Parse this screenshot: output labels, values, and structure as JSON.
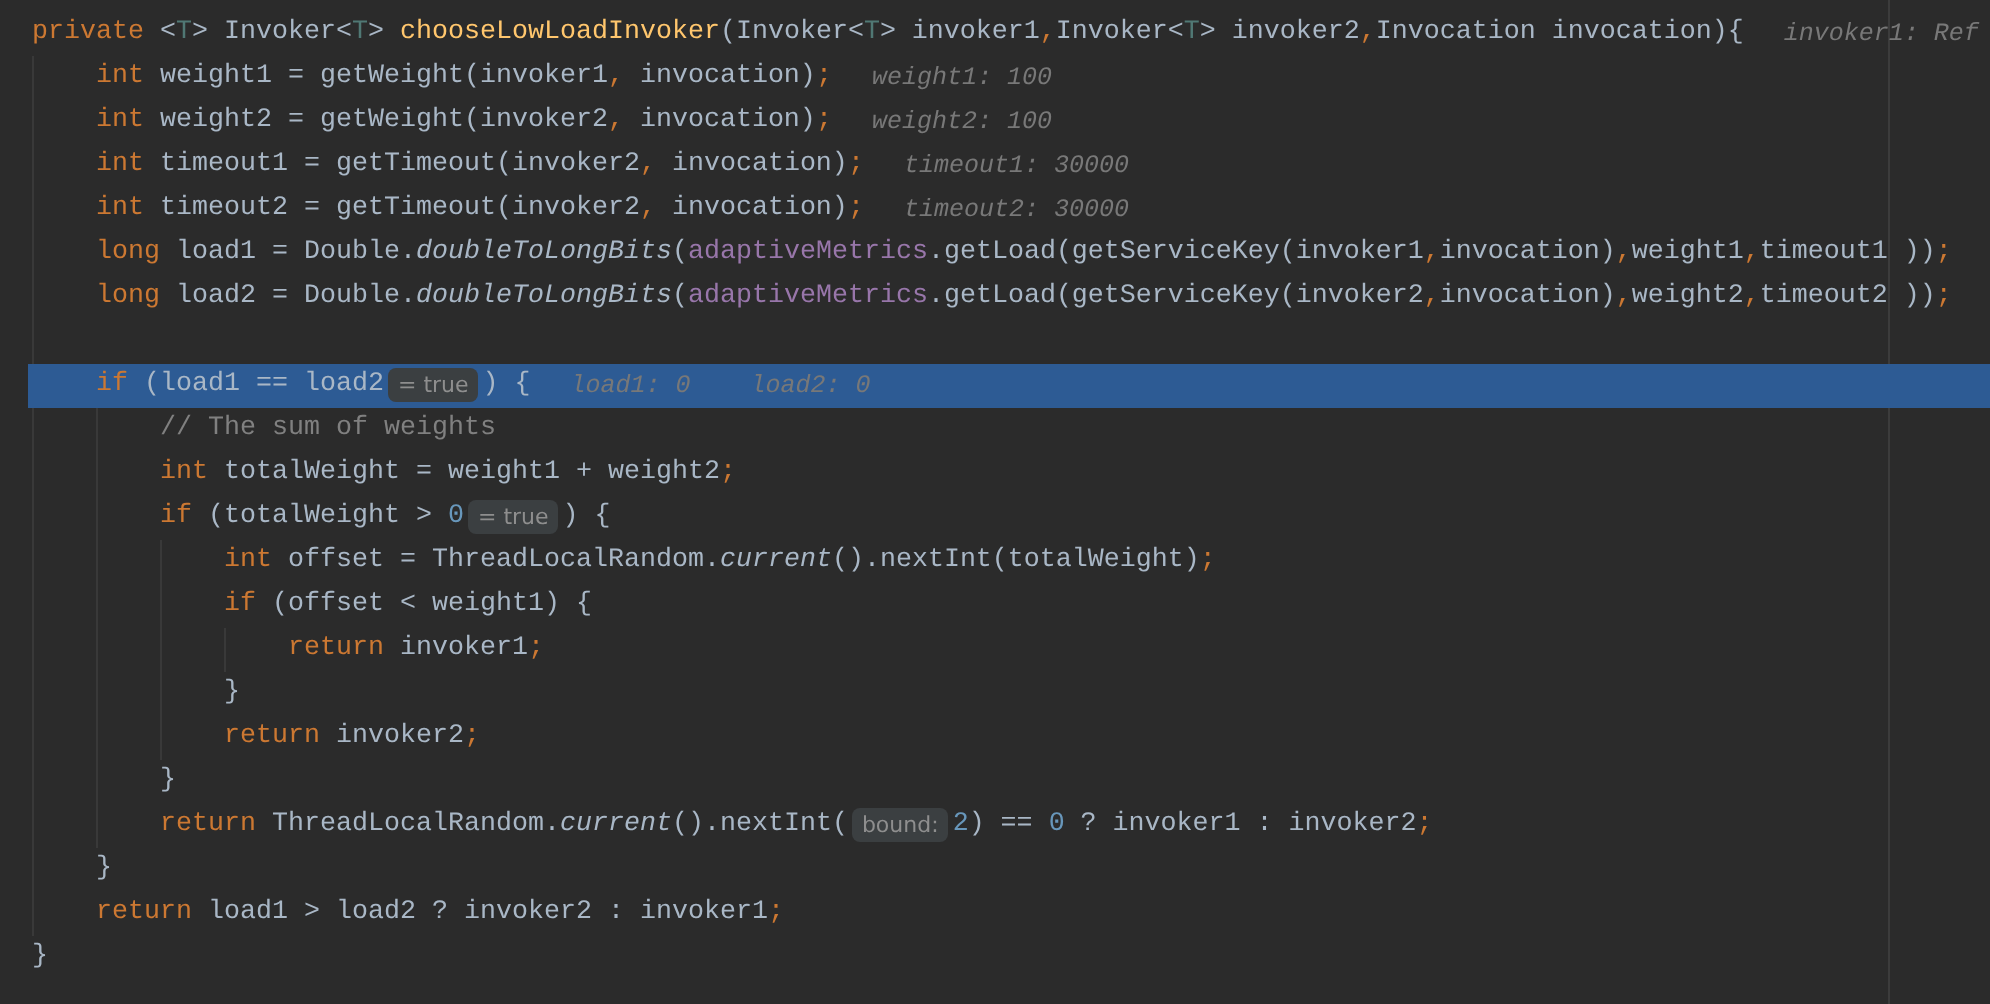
{
  "editor": {
    "lines": [
      {
        "current": false,
        "segments": [
          {
            "kind": "code",
            "tokens": [
              {
                "text": "private ",
                "kind": "kw"
              },
              {
                "text": "<",
                "kind": "plain"
              },
              {
                "text": "T",
                "kind": "tparam"
              },
              {
                "text": "> Invoker<",
                "kind": "plain"
              },
              {
                "text": "T",
                "kind": "tparam"
              },
              {
                "text": "> ",
                "kind": "plain"
              },
              {
                "text": "chooseLowLoadInvoker",
                "kind": "decl"
              },
              {
                "text": "(Invoker<",
                "kind": "plain"
              },
              {
                "text": "T",
                "kind": "tparam"
              },
              {
                "text": "> invoker1",
                "kind": "plain"
              },
              {
                "text": ",",
                "kind": "punct"
              },
              {
                "text": "Invoker<",
                "kind": "plain"
              },
              {
                "text": "T",
                "kind": "tparam"
              },
              {
                "text": "> invoker2",
                "kind": "plain"
              },
              {
                "text": ",",
                "kind": "punct"
              },
              {
                "text": "Invocation invocation){",
                "kind": "plain"
              }
            ]
          },
          {
            "kind": "value",
            "text": "invoker1: Ref"
          }
        ],
        "children": [
          {
            "current": false,
            "segments": [
              {
                "kind": "code",
                "tokens": [
                  {
                    "text": "int ",
                    "kind": "kw"
                  },
                  {
                    "text": "weight1 = getWeight(invoker1",
                    "kind": "plain"
                  },
                  {
                    "text": ", ",
                    "kind": "punct"
                  },
                  {
                    "text": "invocation)",
                    "kind": "plain"
                  },
                  {
                    "text": ";",
                    "kind": "punct"
                  }
                ]
              },
              {
                "kind": "value",
                "text": "weight1: 100"
              }
            ]
          },
          {
            "current": false,
            "segments": [
              {
                "kind": "code",
                "tokens": [
                  {
                    "text": "int ",
                    "kind": "kw"
                  },
                  {
                    "text": "weight2 = getWeight(invoker2",
                    "kind": "plain"
                  },
                  {
                    "text": ", ",
                    "kind": "punct"
                  },
                  {
                    "text": "invocation)",
                    "kind": "plain"
                  },
                  {
                    "text": ";",
                    "kind": "punct"
                  }
                ]
              },
              {
                "kind": "value",
                "text": "weight2: 100"
              }
            ]
          },
          {
            "current": false,
            "segments": [
              {
                "kind": "code",
                "tokens": [
                  {
                    "text": "int ",
                    "kind": "kw"
                  },
                  {
                    "text": "timeout1 = getTimeout(invoker2",
                    "kind": "plain"
                  },
                  {
                    "text": ", ",
                    "kind": "punct"
                  },
                  {
                    "text": "invocation)",
                    "kind": "plain"
                  },
                  {
                    "text": ";",
                    "kind": "punct"
                  }
                ]
              },
              {
                "kind": "value",
                "text": "timeout1: 30000"
              }
            ]
          },
          {
            "current": false,
            "segments": [
              {
                "kind": "code",
                "tokens": [
                  {
                    "text": "int ",
                    "kind": "kw"
                  },
                  {
                    "text": "timeout2 = getTimeout(invoker2",
                    "kind": "plain"
                  },
                  {
                    "text": ", ",
                    "kind": "punct"
                  },
                  {
                    "text": "invocation)",
                    "kind": "plain"
                  },
                  {
                    "text": ";",
                    "kind": "punct"
                  }
                ]
              },
              {
                "kind": "value",
                "text": "timeout2: 30000"
              }
            ]
          },
          {
            "current": false,
            "segments": [
              {
                "kind": "code",
                "tokens": [
                  {
                    "text": "long ",
                    "kind": "kw"
                  },
                  {
                    "text": "load1 = Double.",
                    "kind": "plain"
                  },
                  {
                    "text": "doubleToLongBits",
                    "kind": "static"
                  },
                  {
                    "text": "(",
                    "kind": "plain"
                  },
                  {
                    "text": "adaptiveMetrics",
                    "kind": "field"
                  },
                  {
                    "text": ".getLoad(getServiceKey(invoker1",
                    "kind": "plain"
                  },
                  {
                    "text": ",",
                    "kind": "punct"
                  },
                  {
                    "text": "invocation)",
                    "kind": "plain"
                  },
                  {
                    "text": ",",
                    "kind": "punct"
                  },
                  {
                    "text": "weight1",
                    "kind": "plain"
                  },
                  {
                    "text": ",",
                    "kind": "punct"
                  },
                  {
                    "text": "timeout1 ))",
                    "kind": "plain"
                  },
                  {
                    "text": ";",
                    "kind": "punct"
                  }
                ]
              }
            ]
          },
          {
            "current": false,
            "segments": [
              {
                "kind": "code",
                "tokens": [
                  {
                    "text": "long ",
                    "kind": "kw"
                  },
                  {
                    "text": "load2 = Double.",
                    "kind": "plain"
                  },
                  {
                    "text": "doubleToLongBits",
                    "kind": "static"
                  },
                  {
                    "text": "(",
                    "kind": "plain"
                  },
                  {
                    "text": "adaptiveMetrics",
                    "kind": "field"
                  },
                  {
                    "text": ".getLoad(getServiceKey(invoker2",
                    "kind": "plain"
                  },
                  {
                    "text": ",",
                    "kind": "punct"
                  },
                  {
                    "text": "invocation)",
                    "kind": "plain"
                  },
                  {
                    "text": ",",
                    "kind": "punct"
                  },
                  {
                    "text": "weight2",
                    "kind": "plain"
                  },
                  {
                    "text": ",",
                    "kind": "punct"
                  },
                  {
                    "text": "timeout2 ))",
                    "kind": "plain"
                  },
                  {
                    "text": ";",
                    "kind": "punct"
                  }
                ]
              }
            ]
          },
          {
            "current": false
          },
          {
            "current": true,
            "segments": [
              {
                "kind": "code",
                "tokens": [
                  {
                    "text": "if ",
                    "kind": "kw"
                  },
                  {
                    "text": "(load1 == load2",
                    "kind": "plain"
                  }
                ]
              },
              {
                "kind": "hint",
                "text": "= true"
              },
              {
                "kind": "code",
                "tokens": [
                  {
                    "text": ") {",
                    "kind": "plain"
                  }
                ]
              },
              {
                "kind": "value",
                "text": "load1: 0"
              },
              {
                "kind": "value",
                "text": "load2: 0"
              }
            ],
            "children": [
              {
                "current": false,
                "segments": [
                  {
                    "kind": "code",
                    "tokens": [
                      {
                        "text": "// The sum of weights",
                        "kind": "comment"
                      }
                    ]
                  }
                ]
              },
              {
                "current": false,
                "segments": [
                  {
                    "kind": "code",
                    "tokens": [
                      {
                        "text": "int ",
                        "kind": "kw"
                      },
                      {
                        "text": "totalWeight = weight1 + weight2",
                        "kind": "plain"
                      },
                      {
                        "text": ";",
                        "kind": "punct"
                      }
                    ]
                  }
                ]
              },
              {
                "current": false,
                "segments": [
                  {
                    "kind": "code",
                    "tokens": [
                      {
                        "text": "if ",
                        "kind": "kw"
                      },
                      {
                        "text": "(totalWeight > ",
                        "kind": "plain"
                      },
                      {
                        "text": "0",
                        "kind": "num"
                      }
                    ]
                  },
                  {
                    "kind": "hint",
                    "text": "= true"
                  },
                  {
                    "kind": "code",
                    "tokens": [
                      {
                        "text": ") {",
                        "kind": "plain"
                      }
                    ]
                  }
                ],
                "children": [
                  {
                    "current": false,
                    "segments": [
                      {
                        "kind": "code",
                        "tokens": [
                          {
                            "text": "int ",
                            "kind": "kw"
                          },
                          {
                            "text": "offset = ThreadLocalRandom.",
                            "kind": "plain"
                          },
                          {
                            "text": "current",
                            "kind": "static"
                          },
                          {
                            "text": "().nextInt(totalWeight)",
                            "kind": "plain"
                          },
                          {
                            "text": ";",
                            "kind": "punct"
                          }
                        ]
                      }
                    ]
                  },
                  {
                    "current": false,
                    "segments": [
                      {
                        "kind": "code",
                        "tokens": [
                          {
                            "text": "if ",
                            "kind": "kw"
                          },
                          {
                            "text": "(offset < weight1) {",
                            "kind": "plain"
                          }
                        ]
                      }
                    ],
                    "children": [
                      {
                        "current": false,
                        "segments": [
                          {
                            "kind": "code",
                            "tokens": [
                              {
                                "text": "return ",
                                "kind": "kw"
                              },
                              {
                                "text": "invoker1",
                                "kind": "plain"
                              },
                              {
                                "text": ";",
                                "kind": "punct"
                              }
                            ]
                          }
                        ]
                      }
                    ]
                  },
                  {
                    "current": false,
                    "segments": [
                      {
                        "kind": "code",
                        "tokens": [
                          {
                            "text": "}",
                            "kind": "plain"
                          }
                        ]
                      }
                    ]
                  },
                  {
                    "current": false,
                    "segments": [
                      {
                        "kind": "code",
                        "tokens": [
                          {
                            "text": "return ",
                            "kind": "kw"
                          },
                          {
                            "text": "invoker2",
                            "kind": "plain"
                          },
                          {
                            "text": ";",
                            "kind": "punct"
                          }
                        ]
                      }
                    ]
                  }
                ]
              },
              {
                "current": false,
                "segments": [
                  {
                    "kind": "code",
                    "tokens": [
                      {
                        "text": "}",
                        "kind": "plain"
                      }
                    ]
                  }
                ]
              },
              {
                "current": false,
                "segments": [
                  {
                    "kind": "code",
                    "tokens": [
                      {
                        "text": "return ",
                        "kind": "kw"
                      },
                      {
                        "text": "ThreadLocalRandom.",
                        "kind": "plain"
                      },
                      {
                        "text": "current",
                        "kind": "static"
                      },
                      {
                        "text": "().nextInt(",
                        "kind": "plain"
                      }
                    ]
                  },
                  {
                    "kind": "hint",
                    "text": "bound:"
                  },
                  {
                    "kind": "code",
                    "tokens": [
                      {
                        "text": "2",
                        "kind": "num"
                      },
                      {
                        "text": ") == ",
                        "kind": "plain"
                      },
                      {
                        "text": "0",
                        "kind": "num"
                      },
                      {
                        "text": " ? invoker1 : invoker2",
                        "kind": "plain"
                      },
                      {
                        "text": ";",
                        "kind": "punct"
                      }
                    ]
                  }
                ]
              }
            ]
          },
          {
            "current": false,
            "segments": [
              {
                "kind": "code",
                "tokens": [
                  {
                    "text": "}",
                    "kind": "plain"
                  }
                ]
              }
            ]
          },
          {
            "current": false,
            "segments": [
              {
                "kind": "code",
                "tokens": [
                  {
                    "text": "return ",
                    "kind": "kw"
                  },
                  {
                    "text": "load1 > load2 ? invoker2 : invoker1",
                    "kind": "plain"
                  },
                  {
                    "text": ";",
                    "kind": "punct"
                  }
                ]
              }
            ]
          }
        ]
      },
      {
        "current": false,
        "segments": [
          {
            "kind": "code",
            "tokens": [
              {
                "text": "}",
                "kind": "plain"
              }
            ]
          }
        ]
      }
    ]
  }
}
